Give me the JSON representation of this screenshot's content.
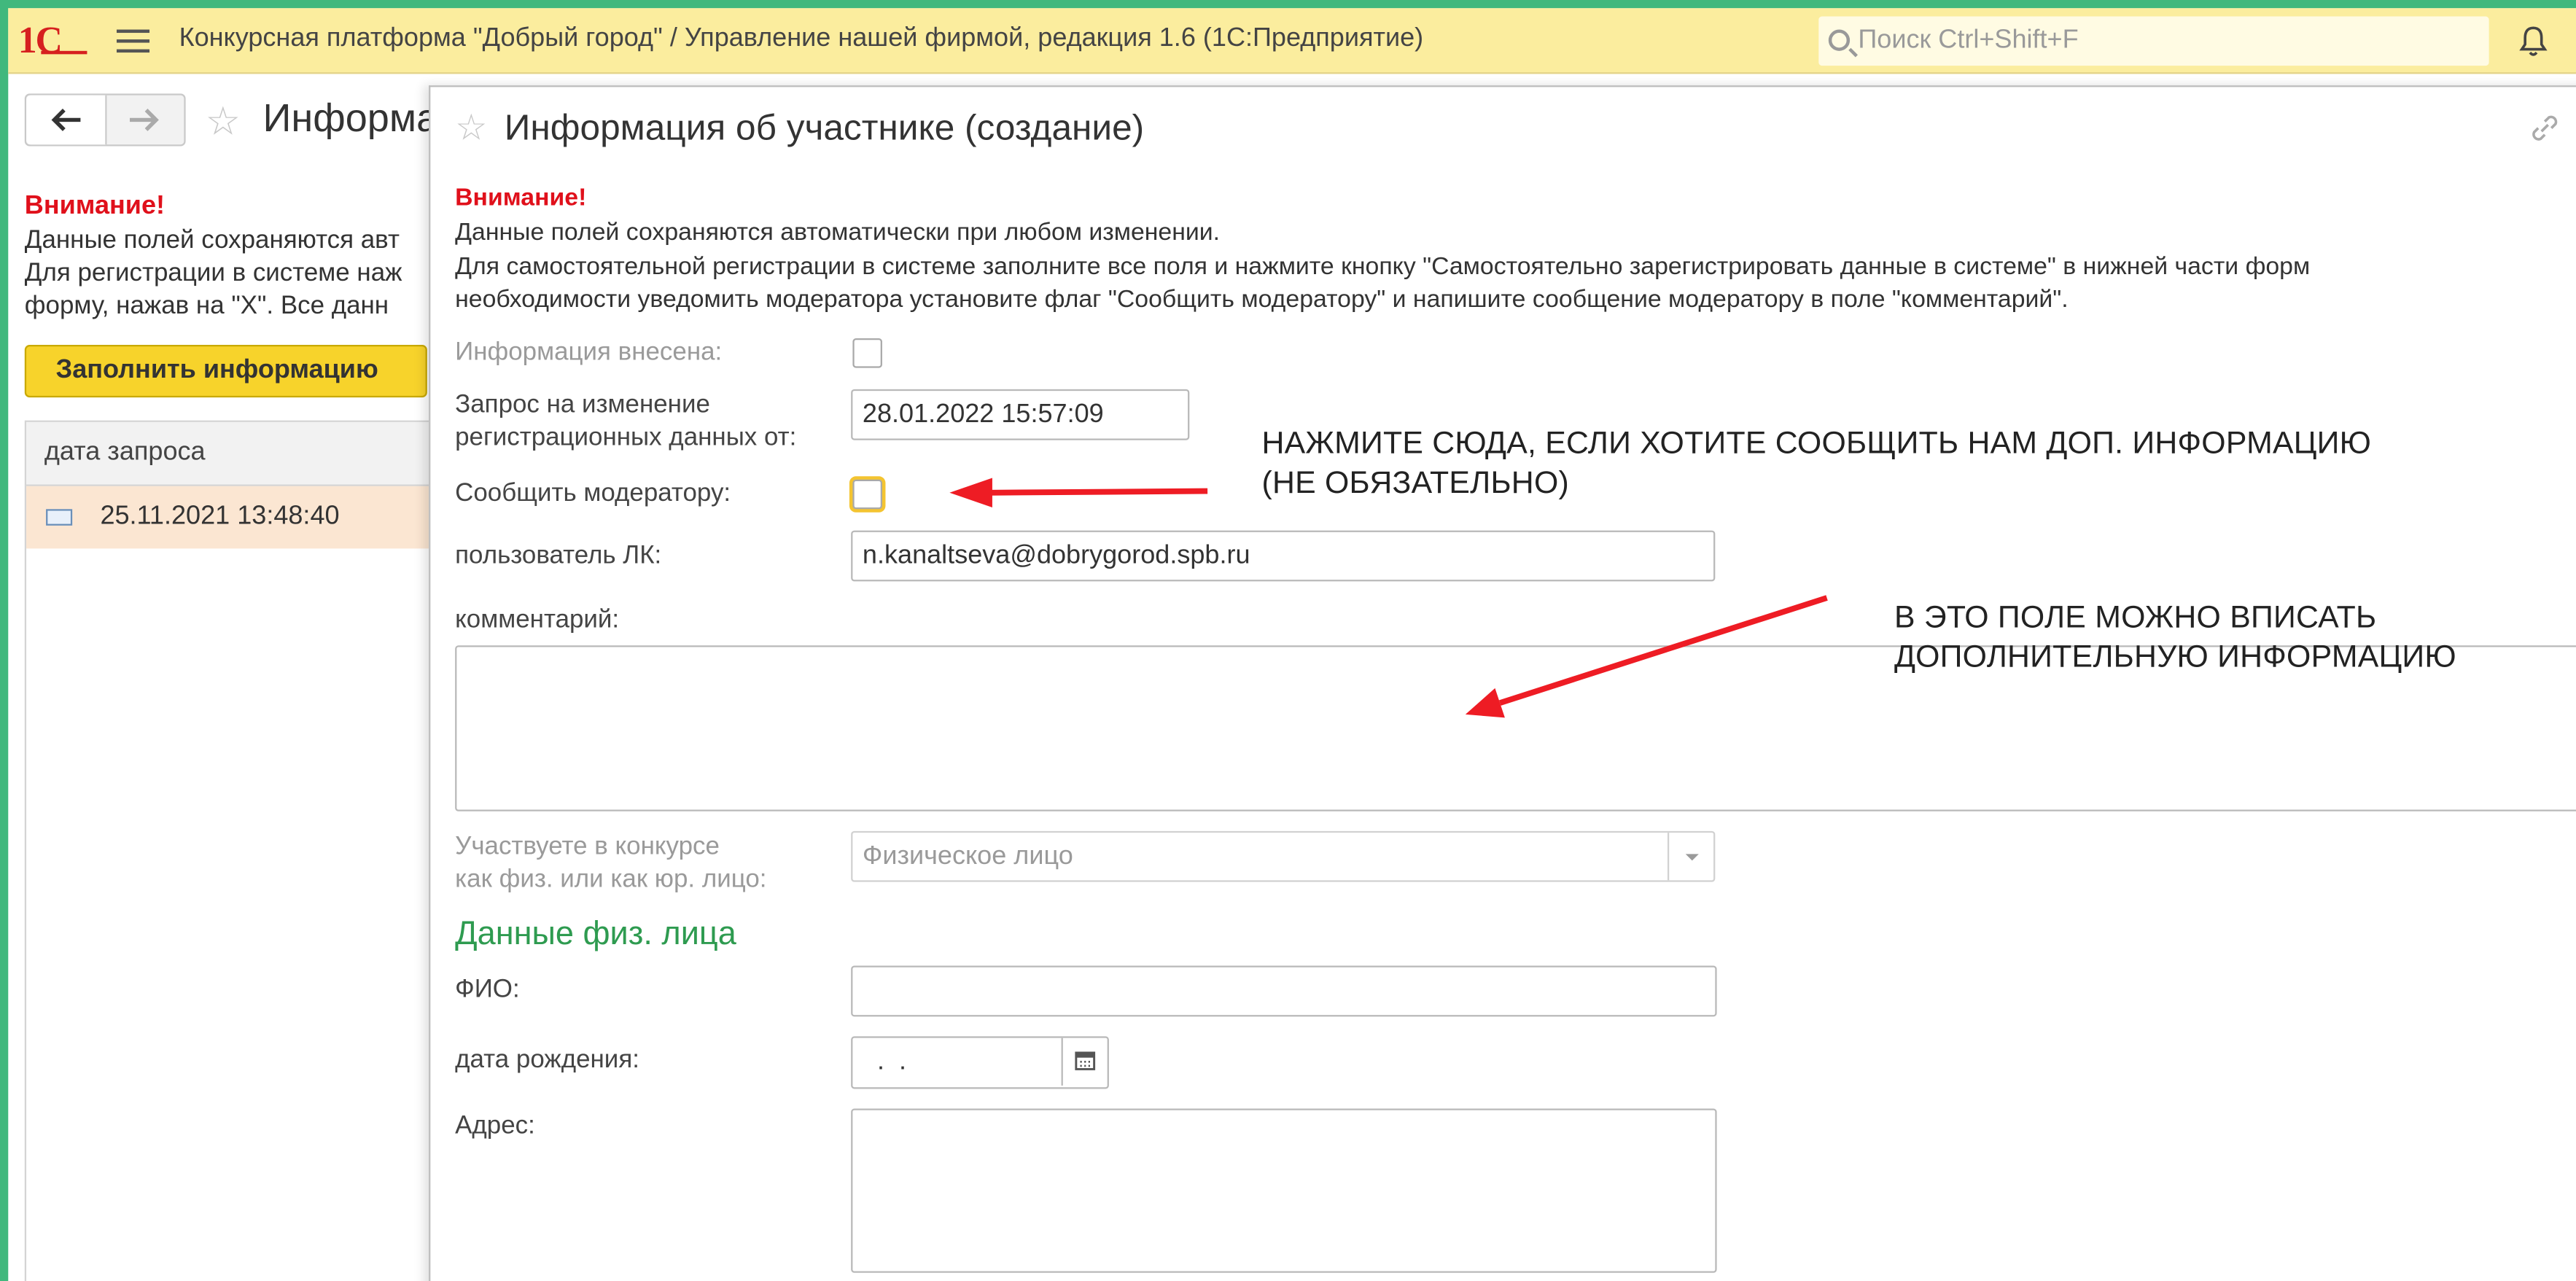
{
  "colors": {
    "accent_green": "#41b87d",
    "topbar_yellow": "#fbed9e",
    "warning_red": "#e0101b",
    "section_green": "#2e9b50",
    "fill_button_yellow": "#f7d32b",
    "arrow_red": "#ee1c24"
  },
  "header": {
    "logo_text": "1С",
    "title": "Конкурсная платформа \"Добрый город\" / Управление нашей фирмой, редакция 1.6  (1С:Предприятие)",
    "search_placeholder": "Поиск Ctrl+Shift+F",
    "icons": [
      "menu-icon",
      "search-icon",
      "bell-icon"
    ]
  },
  "background_form": {
    "title": "Информа",
    "warning": "Внимание!",
    "text_lines": [
      "Данные полей сохраняются авт",
      "Для регистрации в системе наж",
      "форму, нажав на \"X\". Все данн"
    ],
    "fill_button": "Заполнить информацию",
    "table": {
      "column_header": "дата запроса",
      "rows": [
        "25.11.2021 13:48:40"
      ]
    }
  },
  "modal": {
    "title": "Информация об участнике (создание)",
    "warning": "Внимание!",
    "text_lines": [
      "Данные полей сохраняются автоматически при любом изменении.",
      "Для самостоятельной регистрации в системе заполните все поля и нажмите кнопку  \"Самостоятельно зарегистрировать данные в системе\"  в нижней части форм",
      "необходимости уведомить модератора установите флаг \"Сообщить модератору\" и напишите сообщение модератору в поле \"комментарий\"."
    ],
    "fields": {
      "info_entered_label": "Информация внесена:",
      "info_entered_checked": false,
      "change_request_label_1": "Запрос на изменение",
      "change_request_label_2": "регистрационных данных от:",
      "change_request_value": "28.01.2022 15:57:09",
      "notify_moderator_label": "Сообщить модератору:",
      "notify_moderator_checked": false,
      "user_label": "пользователь ЛК:",
      "user_value": "n.kanaltseva@dobrygorod.spb.ru",
      "comment_label": "комментарий:",
      "comment_value": "",
      "participant_type_label_1": "Участвуете в конкурсе",
      "participant_type_label_2": "как физ. или как юр. лицо:",
      "participant_type_value": "Физическое лицо"
    },
    "section_title": "Данные физ. лица",
    "person": {
      "fio_label": "ФИО:",
      "fio_value": "",
      "birth_label": "дата рождения:",
      "birth_value": "  .  .",
      "address_label": "Адрес:",
      "address_value": ""
    }
  },
  "annotations": {
    "notify_hint_1": "НАЖМИТЕ СЮДА, ЕСЛИ ХОТИТЕ СООБЩИТЬ НАМ ДОП. ИНФОРМАЦИЮ",
    "notify_hint_2": "(НЕ ОБЯЗАТЕЛЬНО)",
    "comment_hint_1": "В ЭТО ПОЛЕ МОЖНО ВПИСАТЬ",
    "comment_hint_2": "ДОПОЛНИТЕЛЬНУЮ ИНФОРМАЦИЮ"
  }
}
